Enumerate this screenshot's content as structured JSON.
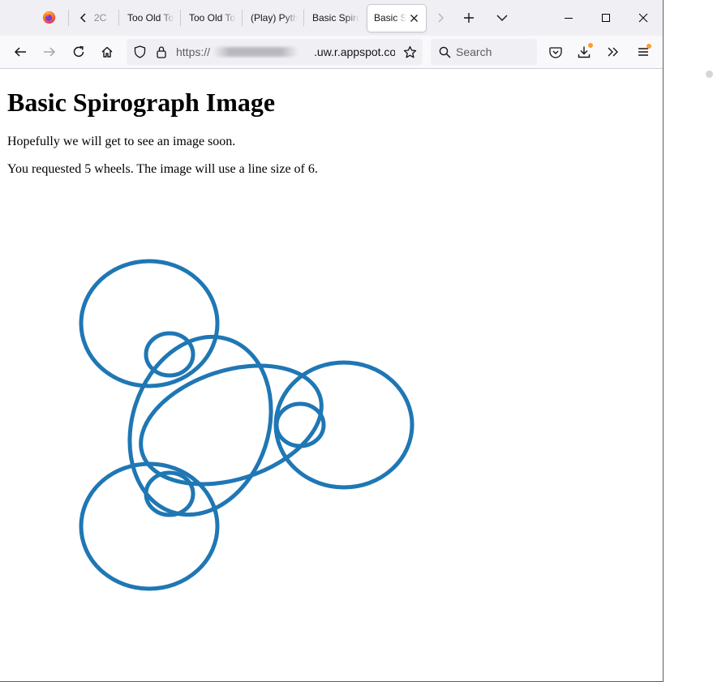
{
  "browser": {
    "tabs": [
      {
        "label": "2C",
        "active": false
      },
      {
        "label": "Too Old To",
        "active": false
      },
      {
        "label": "Too Old To",
        "active": false
      },
      {
        "label": "(Play) Pyth",
        "active": false
      },
      {
        "label": "Basic Spiro",
        "active": false
      },
      {
        "label": "Basic Sp",
        "active": true
      }
    ],
    "icons": {
      "logo": "firefox-icon",
      "new_tab": "plus-icon",
      "list_tabs": "chevron-down-icon",
      "back": "arrow-left-icon",
      "forward": "arrow-right-icon",
      "reload": "reload-icon",
      "home": "home-icon",
      "shield": "shield-icon",
      "lock": "lock-icon",
      "bookmark": "star-icon",
      "search": "search-icon",
      "pocket": "pocket-icon",
      "downloads": "download-icon",
      "overflow": "chevrons-right-icon",
      "menu": "hamburger-icon"
    },
    "url_scheme": "https://",
    "url_rest": ".uw.r.appspot.com/s",
    "search_placeholder": "Search",
    "badge_color": "#ff9b2e"
  },
  "page": {
    "heading": "Basic Spirograph Image",
    "line1": "Hopefully we will get to see an image soon.",
    "line2": "You requested 5 wheels. The image will use a line size of 6."
  },
  "spirograph": {
    "stroke_color": "#1f77b4",
    "wheels": 5
  }
}
